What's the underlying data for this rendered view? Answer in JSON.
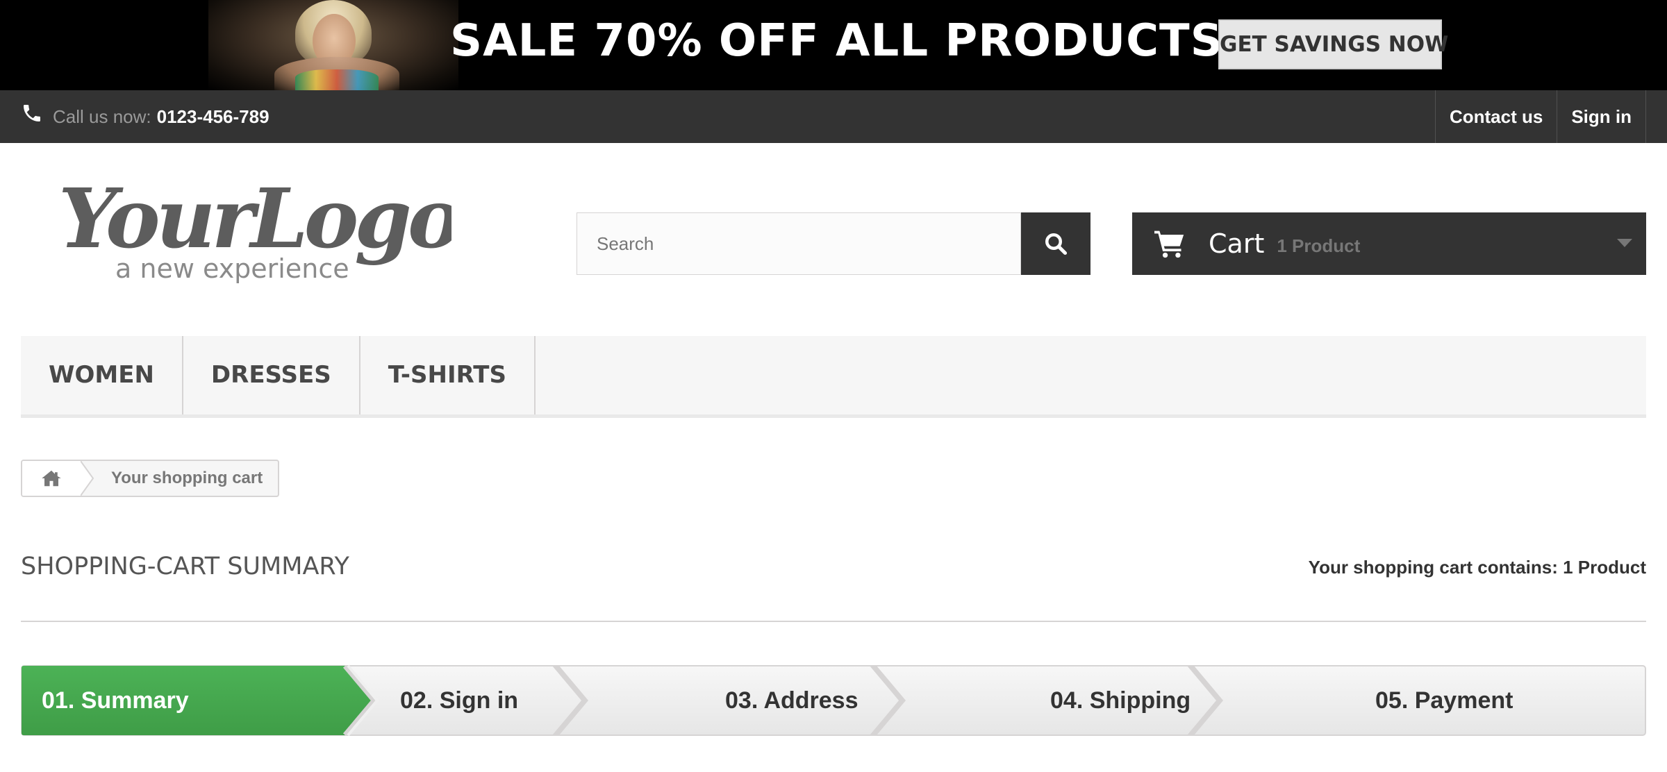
{
  "banner": {
    "headline": "SALE 70% OFF ALL PRODUCTS",
    "cta_label": "GET SAVINGS NOW"
  },
  "topbar": {
    "call_label": "Call us now:",
    "phone": "0123-456-789",
    "links": [
      "Contact us",
      "Sign in"
    ]
  },
  "header": {
    "logo": {
      "wordmark": "YourLogo",
      "tagline": "a new experience"
    },
    "search_placeholder": "Search",
    "cart": {
      "title": "Cart",
      "quantity": "1 Product"
    }
  },
  "nav": {
    "items": [
      "WOMEN",
      "DRESSES",
      "T-SHIRTS"
    ]
  },
  "breadcrumb": {
    "current": "Your shopping cart"
  },
  "page": {
    "title": "SHOPPING-CART SUMMARY",
    "cart_contains": "Your shopping cart contains: 1 Product"
  },
  "steps": [
    {
      "label": "01. Summary",
      "active": true
    },
    {
      "label": "02. Sign in",
      "active": false
    },
    {
      "label": "03. Address",
      "active": false
    },
    {
      "label": "04. Shipping",
      "active": false
    },
    {
      "label": "05. Payment",
      "active": false
    }
  ],
  "colors": {
    "banner_bg": "#000000",
    "topbar_bg": "#333333",
    "active_step": "#46a74e",
    "inactive_step": "#eeeeee"
  }
}
